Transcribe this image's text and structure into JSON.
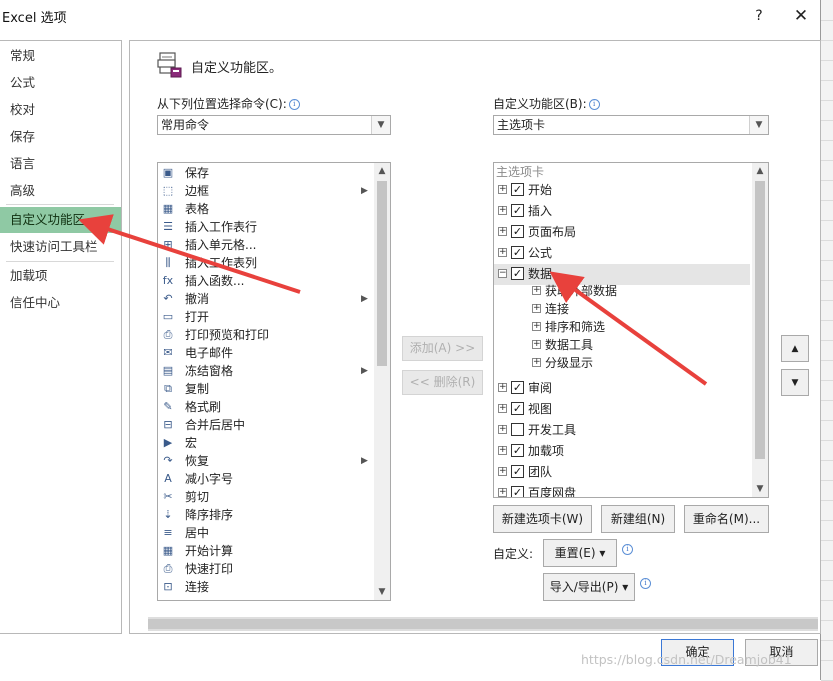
{
  "window": {
    "title": "Excel 选项",
    "help": "?",
    "close": "✕"
  },
  "nav": {
    "items": [
      "常规",
      "公式",
      "校对",
      "保存",
      "语言",
      "高级",
      "自定义功能区",
      "快速访问工具栏",
      "加载项",
      "信任中心"
    ],
    "selected": "自定义功能区"
  },
  "header": {
    "title": "自定义功能区。",
    "icon": "customize-ribbon-icon"
  },
  "left_panel": {
    "label": "从下列位置选择命令(C):",
    "dropdown_value": "常用命令",
    "commands": [
      {
        "label": "保存",
        "icon": "save-icon",
        "glyph": "▣"
      },
      {
        "label": "边框",
        "icon": "border-icon",
        "glyph": "⬚",
        "submenu": true
      },
      {
        "label": "表格",
        "icon": "table-icon",
        "glyph": "▦"
      },
      {
        "label": "插入工作表行",
        "icon": "insert-row-icon",
        "glyph": "☰"
      },
      {
        "label": "插入单元格...",
        "icon": "insert-cell-icon",
        "glyph": "⊞"
      },
      {
        "label": "插入工作表列",
        "icon": "insert-column-icon",
        "glyph": "⫼"
      },
      {
        "label": "插入函数...",
        "icon": "function-icon",
        "glyph": "fx"
      },
      {
        "label": "撤消",
        "icon": "undo-icon",
        "glyph": "↶",
        "submenu": true
      },
      {
        "label": "打开",
        "icon": "open-folder-icon",
        "glyph": "▭"
      },
      {
        "label": "打印预览和打印",
        "icon": "print-preview-icon",
        "glyph": "⎙"
      },
      {
        "label": "电子邮件",
        "icon": "email-icon",
        "glyph": "✉"
      },
      {
        "label": "冻结窗格",
        "icon": "freeze-panes-icon",
        "glyph": "▤",
        "submenu": true
      },
      {
        "label": "复制",
        "icon": "copy-icon",
        "glyph": "⧉"
      },
      {
        "label": "格式刷",
        "icon": "format-painter-icon",
        "glyph": "✎"
      },
      {
        "label": "合并后居中",
        "icon": "merge-center-icon",
        "glyph": "⊟"
      },
      {
        "label": "宏",
        "icon": "macro-icon",
        "glyph": "▶"
      },
      {
        "label": "恢复",
        "icon": "redo-icon",
        "glyph": "↷",
        "submenu": true
      },
      {
        "label": "减小字号",
        "icon": "decrease-font-icon",
        "glyph": "A"
      },
      {
        "label": "剪切",
        "icon": "cut-icon",
        "glyph": "✂"
      },
      {
        "label": "降序排序",
        "icon": "sort-desc-icon",
        "glyph": "⇣"
      },
      {
        "label": "居中",
        "icon": "center-align-icon",
        "glyph": "≡"
      },
      {
        "label": "开始计算",
        "icon": "calculator-icon",
        "glyph": "▦"
      },
      {
        "label": "快速打印",
        "icon": "quick-print-icon",
        "glyph": "⎙"
      },
      {
        "label": "连接",
        "icon": "connection-icon",
        "glyph": "⊡"
      }
    ]
  },
  "middle_buttons": {
    "add": "添加(A) >>",
    "remove": "<< 删除(R)"
  },
  "right_panel": {
    "label": "自定义功能区(B):",
    "dropdown_value": "主选项卡",
    "tree_header": "主选项卡",
    "tree": [
      {
        "label": "开始",
        "checked": true,
        "expanded": false
      },
      {
        "label": "插入",
        "checked": true,
        "expanded": false
      },
      {
        "label": "页面布局",
        "checked": true,
        "expanded": false
      },
      {
        "label": "公式",
        "checked": true,
        "expanded": false
      },
      {
        "label": "数据",
        "checked": true,
        "expanded": true,
        "selected": true,
        "children": [
          "获取外部数据",
          "连接",
          "排序和筛选",
          "数据工具",
          "分级显示"
        ]
      },
      {
        "label": "审阅",
        "checked": true,
        "expanded": false
      },
      {
        "label": "视图",
        "checked": true,
        "expanded": false
      },
      {
        "label": "开发工具",
        "checked": false,
        "expanded": false
      },
      {
        "label": "加载项",
        "checked": true,
        "expanded": false
      },
      {
        "label": "团队",
        "checked": true,
        "expanded": false
      },
      {
        "label": "百度网盘",
        "checked": true,
        "expanded": false
      }
    ],
    "new_tab": "新建选项卡(W)",
    "new_group": "新建组(N)",
    "rename": "重命名(M)...",
    "customize_label": "自定义:",
    "reset": "重置(E) ▾",
    "import_export": "导入/导出(P) ▾"
  },
  "footer": {
    "ok": "确定",
    "cancel": "取消"
  },
  "watermark": "https://blog.csdn.net/Dreamjob41",
  "colors": {
    "nav_selected": "#8fc9a4",
    "annotation_arrow": "#e8413c",
    "selection": "#e5e5e5"
  }
}
